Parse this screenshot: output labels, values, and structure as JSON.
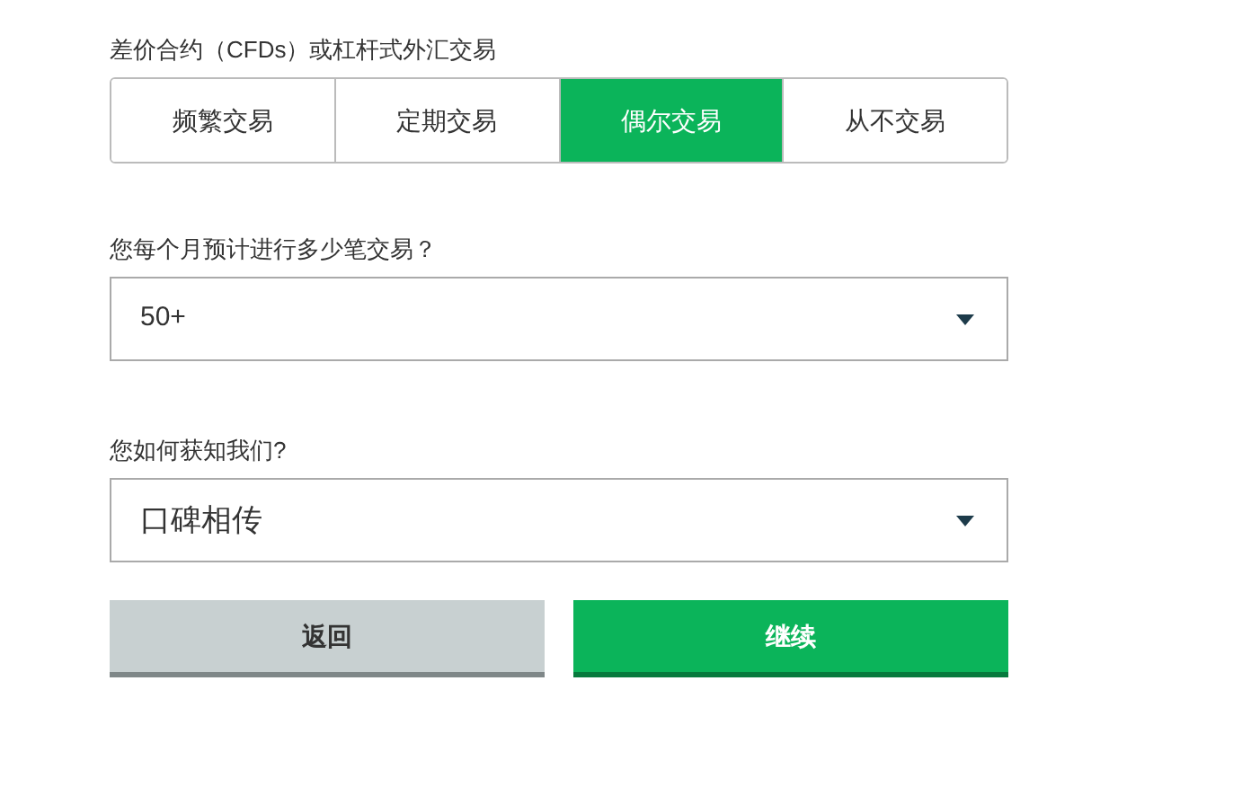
{
  "trade_frequency": {
    "label": "差价合约（CFDs）或杠杆式外汇交易",
    "options": [
      {
        "label": "频繁交易",
        "selected": false
      },
      {
        "label": "定期交易",
        "selected": false
      },
      {
        "label": "偶尔交易",
        "selected": true
      },
      {
        "label": "从不交易",
        "selected": false
      }
    ]
  },
  "monthly_trades": {
    "label": "您每个月预计进行多少笔交易？",
    "value": "50+"
  },
  "referral": {
    "label": "您如何获知我们?",
    "value": "口碑相传"
  },
  "buttons": [
    {
      "label": "返回",
      "kind": "secondary"
    },
    {
      "label": "继续",
      "kind": "primary"
    }
  ]
}
